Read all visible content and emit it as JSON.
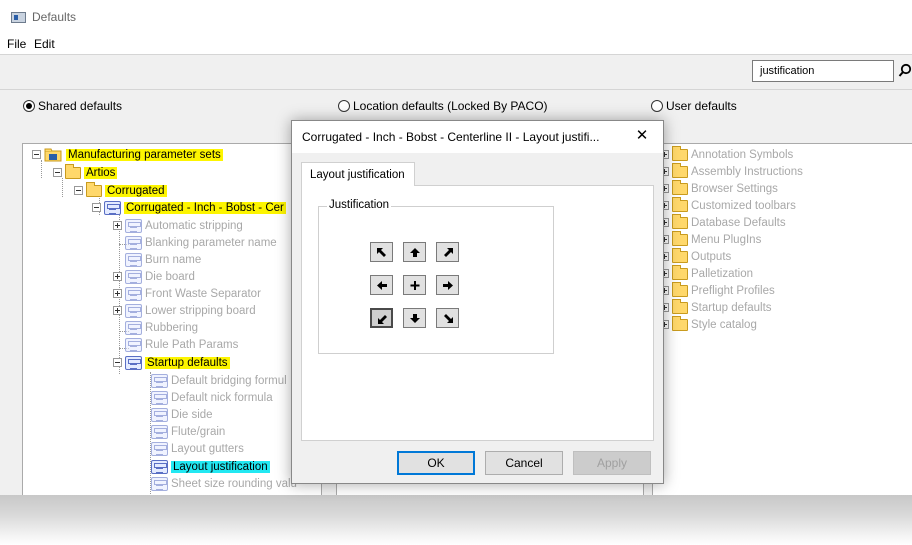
{
  "window": {
    "title": "Defaults"
  },
  "menu": {
    "file": "File",
    "edit": "Edit"
  },
  "search": {
    "value": "justification",
    "icon": "search-icon"
  },
  "radios": {
    "shared": {
      "label": "Shared defaults",
      "checked": true
    },
    "location": {
      "label": "Location defaults (Locked By PACO)",
      "checked": false
    },
    "user": {
      "label": "User defaults",
      "checked": false
    }
  },
  "left_tree": {
    "root": "Manufacturing parameter sets",
    "artios": "Artios",
    "corrugated": "Corrugated",
    "corr_item": "Corrugated - Inch - Bobst - Cer",
    "items": [
      "Automatic stripping",
      "Blanking parameter name",
      "Burn name",
      "Die board",
      "Front Waste Separator",
      "Lower stripping board",
      "Rubbering",
      "Rule Path Params"
    ],
    "startup": "Startup defaults",
    "startup_items": [
      "Default bridging formul",
      "Default nick formula",
      "Die side",
      "Flute/grain",
      "Layout gutters",
      "Layout justification",
      "Sheet size rounding valu"
    ]
  },
  "right_tree": {
    "items": [
      "Annotation Symbols",
      "Assembly Instructions",
      "Browser Settings",
      "Customized toolbars",
      "Database Defaults",
      "Menu PlugIns",
      "Outputs",
      "Palletization",
      "Preflight Profiles",
      "Startup defaults",
      "Style catalog"
    ]
  },
  "dialog": {
    "title": "Corrugated - Inch - Bobst - Centerline II - Layout justifi...",
    "close": "✕",
    "tab": "Layout justification",
    "group": "Justification",
    "selected": "bottom-left",
    "ok": "OK",
    "cancel": "Cancel",
    "apply": "Apply"
  },
  "colors": {
    "highlight": "#fdf500",
    "selection": "#22e8f2",
    "accent": "#0078d7"
  }
}
